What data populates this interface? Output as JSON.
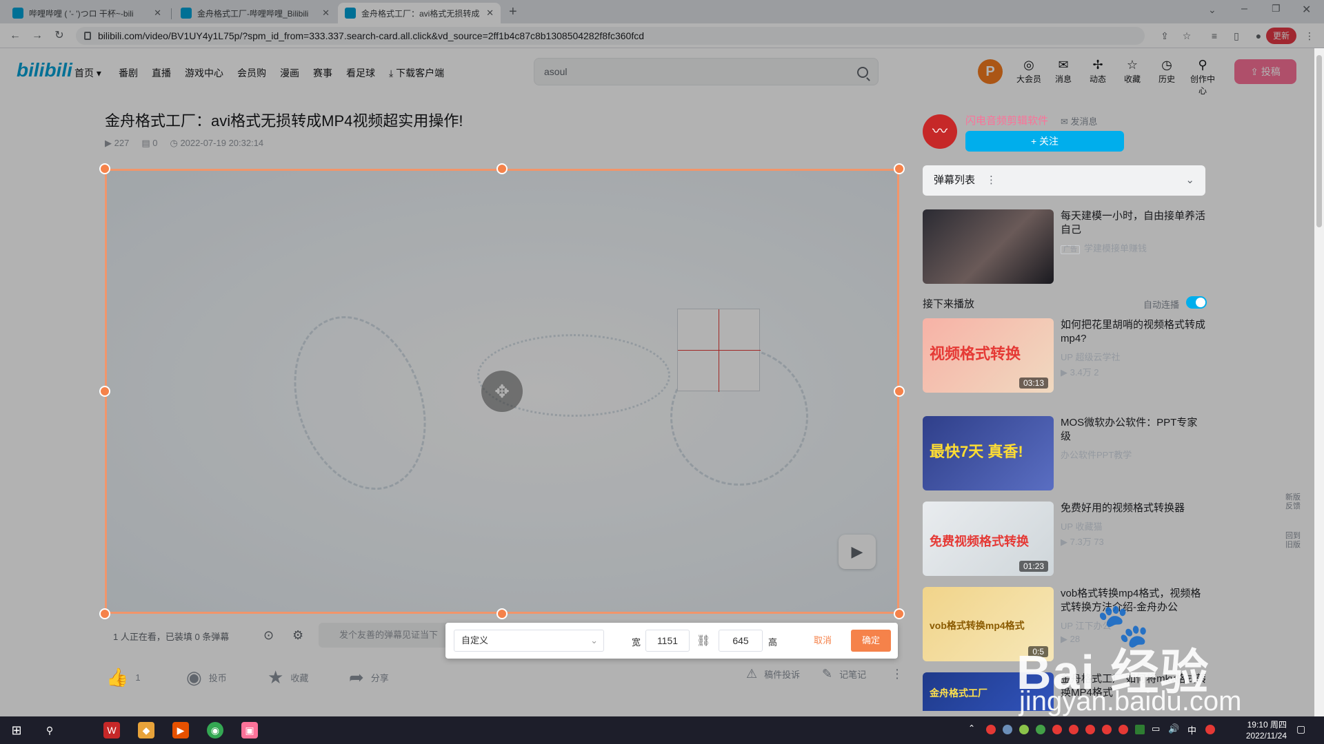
{
  "browser": {
    "tabs": [
      {
        "title": "哔哩哔哩 ( '- ')つロ 干杯~-bili"
      },
      {
        "title": "金舟格式工厂-哔哩哔哩_Bilibili"
      },
      {
        "title": "金舟格式工厂：avi格式无损转成"
      }
    ],
    "url": "bilibili.com/video/BV1UY4y1L75p/?spm_id_from=333.337.search-card.all.click&vd_source=2ff1b4c87c8b1308504282f8fc360fcd",
    "update_label": "更新"
  },
  "header": {
    "logo": "bilibili",
    "nav": [
      "首页",
      "番剧",
      "直播",
      "游戏中心",
      "会员购",
      "漫画",
      "赛事",
      "看足球",
      "下载客户端"
    ],
    "search_value": "asoul",
    "avatar_letter": "P",
    "icons": [
      {
        "label": "大会员",
        "icon": "vip-icon"
      },
      {
        "label": "消息",
        "icon": "message-icon"
      },
      {
        "label": "动态",
        "icon": "dynamic-icon"
      },
      {
        "label": "收藏",
        "icon": "favorite-icon"
      },
      {
        "label": "历史",
        "icon": "history-icon"
      },
      {
        "label": "创作中心",
        "icon": "creator-icon"
      }
    ],
    "upload_label": "投稿"
  },
  "video": {
    "title": "金舟格式工厂：avi格式无损转成MP4视频超实用操作!",
    "views": "227",
    "danmaku": "0",
    "date": "2022-07-19 20:32:14"
  },
  "danmaku_bar": {
    "status": "1 人正在看，已装填 0 条弹幕",
    "placeholder": "发个友善的弹幕见证当下"
  },
  "crop_tool": {
    "preset": "自定义",
    "width_label": "宽",
    "width": "1151",
    "height": "645",
    "height_label": "高",
    "cancel": "取消",
    "confirm": "确定"
  },
  "actions": {
    "like": "1",
    "coin": "投币",
    "favorite": "收藏",
    "share": "分享",
    "report": "稿件投诉",
    "notes": "记笔记"
  },
  "sidebar": {
    "up_name": "闪电音频剪辑软件",
    "up_msg": "发消息",
    "follow": "+ 关注",
    "danmaku_list": "弹幕列表",
    "next_label": "接下来播放",
    "autoplay_label": "自动连播",
    "ad_tag": "广告",
    "cards": [
      {
        "title": "每天建模一小时，自由接单养活自己",
        "up": "学建模接单赚钱",
        "stats": "",
        "duration": "",
        "thumb_text": ""
      },
      {
        "title": "如何把花里胡哨的视频格式转成mp4?",
        "up": "超级云学社",
        "stats": "3.4万  2",
        "duration": "03:13",
        "thumb_text": "视频格式转换"
      },
      {
        "title": "MOS微软办公软件：PPT专家级",
        "up": "办公软件PPT教学",
        "stats": "",
        "duration": "",
        "thumb_text": "最快7天 真香!"
      },
      {
        "title": "免费好用的视频格式转换器",
        "up": "收藏猫",
        "stats": "7.3万  73",
        "duration": "01:23",
        "thumb_text": "免费视频格式转换"
      },
      {
        "title": "vob格式转换mp4格式，视频格式转换方法介绍-金舟办公",
        "up": "江下办公",
        "stats": "28",
        "duration": "0:5",
        "thumb_text": "vob格式转换mp4格式"
      },
      {
        "title": "金舟格式工厂 如何将mkv格式转换MP4格式",
        "up": "",
        "stats": "",
        "duration": "",
        "thumb_text": "金舟格式工厂"
      }
    ],
    "feedback_new": "新版反馈",
    "feedback_old": "回到旧版"
  },
  "watermark": {
    "line1": "Bai  经验",
    "line2": "jingyan.baidu.com"
  },
  "taskbar": {
    "time": "19:10 周四",
    "date": "2022/11/24"
  },
  "colors": {
    "bili_blue": "#00a1d6",
    "pink": "#fb7299",
    "crop_orange": "#f5824a",
    "follow_blue": "#00aeec"
  }
}
